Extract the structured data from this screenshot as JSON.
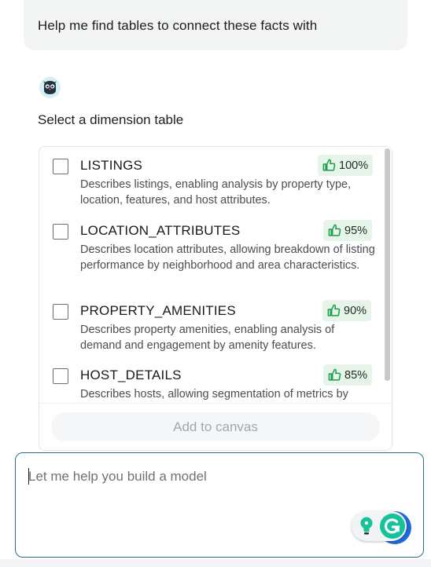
{
  "chat": {
    "user_message": "Help me find tables to connect these facts with",
    "assistant_prompt": "Select a dimension table"
  },
  "dimension_tables": [
    {
      "name": "LISTINGS",
      "confidence": "100%",
      "description": "Describes listings, enabling analysis by property type, location, features, and host attributes.",
      "checked": false
    },
    {
      "name": "LOCATION_ATTRIBUTES",
      "confidence": "95%",
      "description": "Describes location attributes, allowing breakdown of listing performance by neighborhood and area characteristics.",
      "checked": false
    },
    {
      "name": "PROPERTY_AMENITIES",
      "confidence": "90%",
      "description": "Describes property amenities, enabling analysis of demand and engagement by amenity features.",
      "checked": false
    },
    {
      "name": "HOST_DETAILS",
      "confidence": "85%",
      "description": "Describes hosts, allowing segmentation of metrics by",
      "checked": false
    }
  ],
  "actions": {
    "add_to_canvas_label": "Add to canvas"
  },
  "composer": {
    "placeholder": "Let me help you build a model"
  },
  "icons": {
    "avatar": "assistant-bot-icon",
    "badge": "thumbs-up-icon",
    "composer_tools": [
      "lightbulb-icon",
      "grammarly-icon"
    ]
  },
  "colors": {
    "badge_bg": "#e6f4ea",
    "badge_icon": "#1e9e4a",
    "composer_border": "#2b6a8f",
    "grammarly": "#15c39a"
  }
}
